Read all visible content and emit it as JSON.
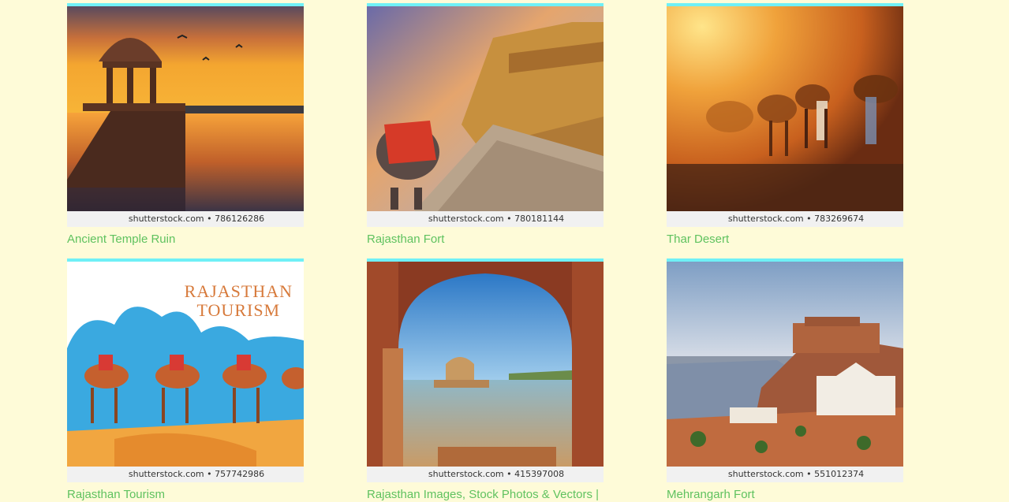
{
  "colors": {
    "background": "#fefbd8",
    "top_border": "#6ff0f6",
    "caption_link": "#5fc25f",
    "watermark_bar": "#f1f1f1"
  },
  "results": [
    {
      "caption": "Ancient Temple Ruin",
      "watermark": "shutterstock.com • 786126286",
      "image": "sunset-lake-chhatri-image"
    },
    {
      "caption": "Rajasthan Fort",
      "watermark": "shutterstock.com • 780181144",
      "image": "fort-elephant-road-image"
    },
    {
      "caption": "Thar Desert",
      "watermark": "shutterstock.com • 783269674",
      "image": "desert-camels-image"
    },
    {
      "caption": "Rajasthan Tourism",
      "watermark": "shutterstock.com • 757742986",
      "image": "rajasthan-tourism-illustration",
      "poster_text_line1": "RAJASTHAN",
      "poster_text_line2": "TOURISM"
    },
    {
      "caption": "Rajasthan Images, Stock Photos & Vectors |",
      "watermark": "shutterstock.com • 415397008",
      "image": "arch-lake-view-image"
    },
    {
      "caption": "Mehrangarh Fort",
      "watermark": "shutterstock.com • 551012374",
      "image": "mehrangarh-fort-city-image"
    }
  ]
}
